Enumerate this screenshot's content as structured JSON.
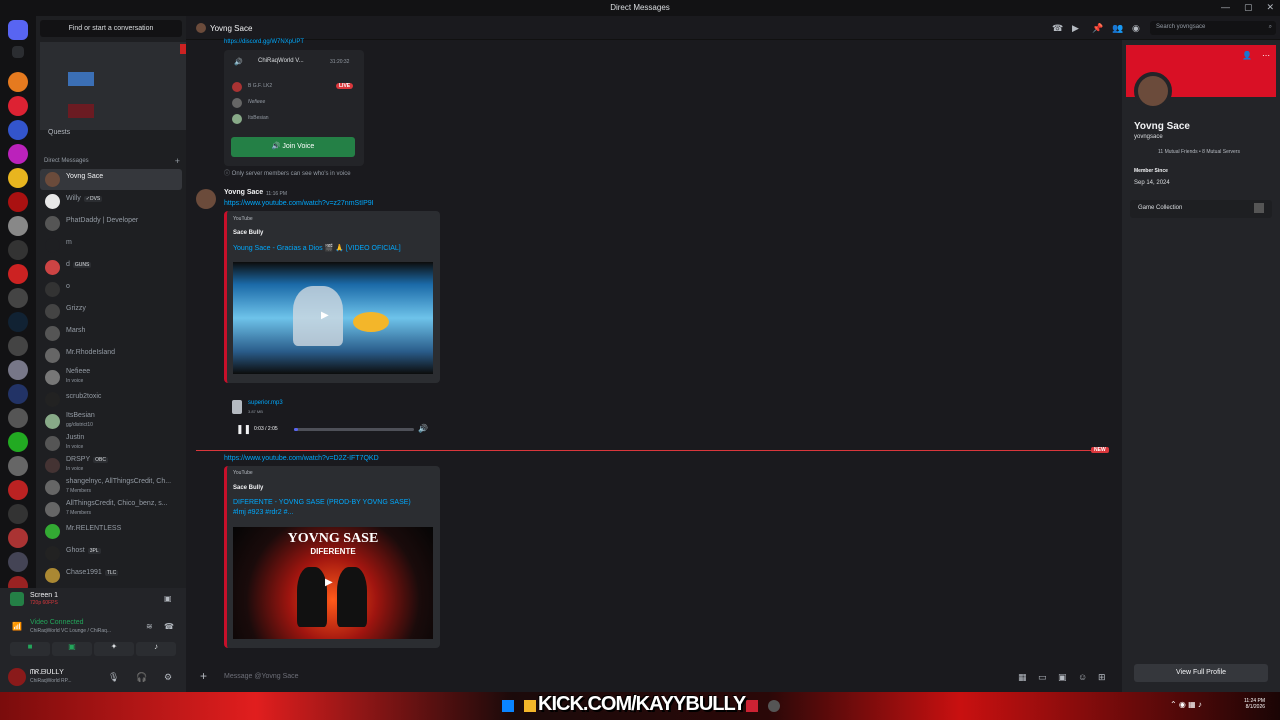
{
  "titlebar": {
    "title": "Direct Messages",
    "icon": "discord-icon",
    "controls": [
      "—",
      "▢",
      "✕"
    ]
  },
  "search": {
    "label": "Find or start a conversation"
  },
  "stream_preview": {
    "quests_label": "Quests"
  },
  "dm_section": {
    "label": "Direct Messages",
    "add": "+"
  },
  "dms": [
    {
      "name": "Yovng Sace",
      "active": true,
      "color": "#6b4b3b"
    },
    {
      "name": "Willy",
      "tag": "✓DVS",
      "color": "#e8e8e8"
    },
    {
      "name": "PhatDaddy | Developer",
      "color": "#555"
    },
    {
      "name": "m",
      "color": "#1e1f22"
    },
    {
      "name": "d",
      "tag": "GUNS",
      "color": "#c44"
    },
    {
      "name": "o",
      "color": "#333"
    },
    {
      "name": "Grizzy",
      "color": "#444"
    },
    {
      "name": "Marsh",
      "color": "#555"
    },
    {
      "name": "Mr.RhodeIsland",
      "color": "#666"
    },
    {
      "name": "Nefieee",
      "sub": "In voice",
      "color": "#777"
    },
    {
      "name": "scrub2toxic",
      "color": "#222"
    },
    {
      "name": "ItsBesian",
      "sub": "gg/district10",
      "color": "#8a8"
    },
    {
      "name": "Justin",
      "sub": "In voice",
      "color": "#555"
    },
    {
      "name": "DRSPY",
      "tag": "OBC",
      "sub": "In voice",
      "color": "#433"
    },
    {
      "name": "shangelnyc, AllThingsCredit, Ch...",
      "sub": "7 Members",
      "color": "#666"
    },
    {
      "name": "AllThingsCredit, Chico_benz, s...",
      "sub": "7 Members",
      "color": "#666"
    },
    {
      "name": "Mr.RELENTLESS",
      "color": "#3a3"
    },
    {
      "name": "Ghost",
      "tag": "3PL",
      "color": "#222"
    },
    {
      "name": "Chase1991",
      "tag": "TLC",
      "color": "#a83"
    }
  ],
  "bottom": {
    "screen_title": "Screen 1",
    "screen_sub": "720p 60FPS",
    "video_status": "Video Connected",
    "video_channel": "ChiRaqWorld VC Lounge / ChiRaq...",
    "user_name": "ᗰᖇ.ᗷᑌᒪᒪY",
    "user_status": "ChiRaqWorld RP..."
  },
  "header": {
    "channel_name": "Yovng Sace",
    "search_placeholder": "Search yovngsace"
  },
  "messages": {
    "invite_link": "https://discord.gg/W7NXpUPT",
    "voice_card": {
      "title": "ChiRaqWorld V...",
      "time": "31:20:32",
      "live": "LIVE",
      "members": [
        "B G.F. LK2",
        "Nefieee",
        "ItsBesian"
      ],
      "join_label": "Join Voice",
      "note": "Only server members can see who's in voice"
    },
    "msg2": {
      "author": "Yovng Sace",
      "time": "11:16 PM",
      "link": "https://www.youtube.com/watch?v=z27nmStIP9I",
      "provider": "YouTube",
      "channel": "Sace Bully",
      "video_title": "Young Sace - Gracias a Dios 🎬 🙏 [VIDEO OFICIAL]"
    },
    "audio": {
      "file": "superior.mp3",
      "size": "3.87 MB",
      "time": "0:03 / 2:05",
      "progress": 0.03
    },
    "new_label": "NEW",
    "msg3": {
      "link": "https://www.youtube.com/watch?v=D2Z-IFT7QKD",
      "provider": "YouTube",
      "channel": "Sace Bully",
      "video_title": "DIFERENTE - YOVNG SASE (PROD-BY YOVNG SASE)",
      "tags": "#lmj #923 #rdr2 #...",
      "thumb_title": "YOVNG SASE",
      "thumb_sub": "DIFERENTE"
    }
  },
  "composer": {
    "placeholder": "Message @Yovng Sace"
  },
  "profile": {
    "display_name": "Yovng Sace",
    "username": "yovngsace",
    "mutual": "11 Mutual Friends • 8 Mutual Servers",
    "member_since_label": "Member Since",
    "member_since": "Sep 14, 2024",
    "game_collection": "Game Collection",
    "view_full": "View Full Profile"
  },
  "overlay": {
    "kick": "KICK.COM/KAYYBULLY"
  },
  "taskbar": {
    "time": "11:24 PM",
    "date": "8/1/2026"
  },
  "colors": {
    "accent": "#5865f2",
    "brand_red": "#d91025",
    "join_green": "#248046",
    "link": "#00a8fc"
  }
}
